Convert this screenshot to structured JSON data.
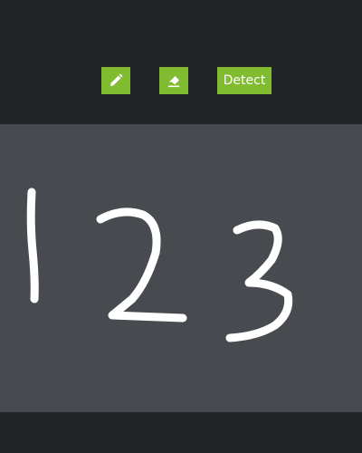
{
  "toolbar": {
    "pencil": {
      "icon": "pencil-icon"
    },
    "eraser": {
      "icon": "eraser-icon"
    },
    "detect_label": "Detect"
  },
  "colors": {
    "background": "#222528",
    "canvas": "#474b50",
    "accent": "#80bb30",
    "stroke": "#ffffff"
  }
}
